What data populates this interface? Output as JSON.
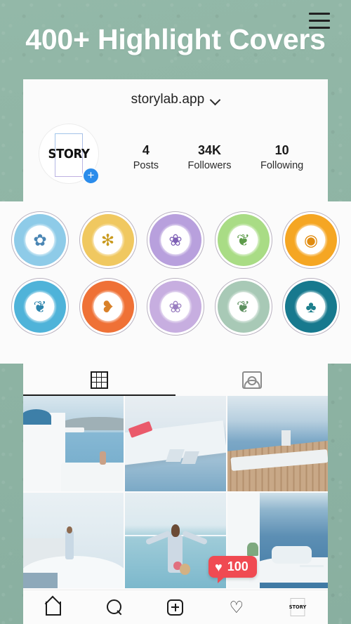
{
  "headline": {
    "text": "400+ Highlight Covers"
  },
  "theme": {
    "background": "#8fb5a5",
    "card": "#fbfbfb",
    "accent_blue": "#2b8ceb",
    "like_red": "#f04a52",
    "text": "#1a1a1a"
  },
  "profile": {
    "username": "storylab.app",
    "chevron_icon": "chevron-down-icon",
    "menu_icon": "hamburger-menu-icon",
    "avatar_label": "STORY",
    "avatar_add_icon": "plus-icon",
    "stats": [
      {
        "num": "4",
        "label": "Posts"
      },
      {
        "num": "34K",
        "label": "Followers"
      },
      {
        "num": "10",
        "label": "Following"
      }
    ]
  },
  "highlights": {
    "rows": [
      [
        {
          "name": "lotus",
          "icon": "✿",
          "ring": "#8ecbe8",
          "ink": "#4b86b4"
        },
        {
          "name": "sunflower",
          "icon": "✻",
          "ring": "#f0c860",
          "ink": "#c99a1e"
        },
        {
          "name": "iris",
          "icon": "❀",
          "ring": "#b8a0dd",
          "ink": "#7e5fb5"
        },
        {
          "name": "ginkgo-leaf",
          "icon": "❦",
          "ring": "#a9dc85",
          "ink": "#5d9b4a"
        },
        {
          "name": "orange-slice",
          "icon": "◉",
          "ring": "#f5a623",
          "ink": "#e08b10"
        }
      ],
      [
        {
          "name": "seashell",
          "icon": "❦",
          "ring": "#4fb3d9",
          "ink": "#2f86ad"
        },
        {
          "name": "autumn-leaf",
          "icon": "❥",
          "ring": "#ef7136",
          "ink": "#d9812a"
        },
        {
          "name": "butterfly",
          "icon": "❀",
          "ring": "#c7aee0",
          "ink": "#9a7fc0"
        },
        {
          "name": "green-leaf",
          "icon": "❦",
          "ring": "#a8c9b6",
          "ink": "#5d9060"
        },
        {
          "name": "cactus",
          "icon": "♣",
          "ring": "#17798e",
          "ink": "#1d7f8c"
        }
      ]
    ]
  },
  "tabs": [
    {
      "name": "grid-tab",
      "icon": "grid-icon",
      "active": true
    },
    {
      "name": "tagged-tab",
      "icon": "tagged-person-icon",
      "active": false
    }
  ],
  "photos": [
    {
      "name": "santorini-church-sea"
    },
    {
      "name": "airplane-wing-over-sea"
    },
    {
      "name": "wooden-dock-pier"
    },
    {
      "name": "woman-on-white-rooftop"
    },
    {
      "name": "woman-arms-outstretched-sea"
    },
    {
      "name": "white-terrace-sea-view"
    }
  ],
  "like_badge": {
    "heart_icon": "♥",
    "count": "100"
  },
  "bottom_nav": [
    {
      "name": "home",
      "icon": "home-icon"
    },
    {
      "name": "search",
      "icon": "search-icon"
    },
    {
      "name": "create",
      "icon": "plus-square-icon"
    },
    {
      "name": "activity",
      "icon": "heart-icon"
    },
    {
      "name": "profile",
      "icon": "story-avatar-icon",
      "label": "STORY"
    }
  ]
}
